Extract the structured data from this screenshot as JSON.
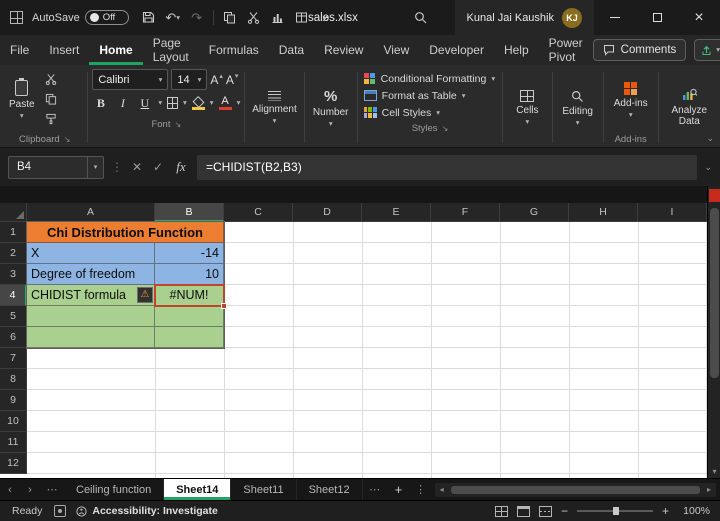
{
  "colors": {
    "accent_green": "#21A366",
    "title_fill_orange": "#ED7D31",
    "data_fill_blue": "#8EB4E3",
    "data_fill_green": "#A9D08E",
    "error_selection_red": "#C0452A",
    "addins_orange": "#E8590C"
  },
  "title_bar": {
    "autosave_label": "AutoSave",
    "autosave_state": "Off",
    "file_name": "sales.xlsx",
    "user_name": "Kunal Jai Kaushik",
    "user_initials": "KJ"
  },
  "menu": {
    "items": [
      "File",
      "Insert",
      "Home",
      "Page Layout",
      "Formulas",
      "Data",
      "Review",
      "View",
      "Developer",
      "Help",
      "Power Pivot"
    ],
    "active_item": "Home",
    "comments_label": "Comments"
  },
  "ribbon": {
    "paste_label": "Paste",
    "clipboard_group_label": "Clipboard",
    "font_name": "Calibri",
    "font_size": "14",
    "bold_label": "B",
    "italic_label": "I",
    "underline_label": "U",
    "font_group_label": "Font",
    "alignment_label": "Alignment",
    "number_label": "Number",
    "conditional_formatting_label": "Conditional Formatting",
    "format_as_table_label": "Format as Table",
    "cell_styles_label": "Cell Styles",
    "styles_group_label": "Styles",
    "cells_label": "Cells",
    "editing_label": "Editing",
    "addins_label": "Add-ins",
    "addins_group_label": "Add-ins",
    "analyze_data_label": "Analyze Data"
  },
  "formula_bar": {
    "name_box": "B4",
    "fx_label": "fx",
    "formula": "=CHIDIST(B2,B3)"
  },
  "grid": {
    "column_headers": [
      "A",
      "B",
      "C",
      "D",
      "E",
      "F",
      "G",
      "H",
      "I"
    ],
    "row_headers": [
      "1",
      "2",
      "3",
      "4",
      "5",
      "6",
      "7",
      "8",
      "9",
      "10",
      "11",
      "12"
    ],
    "selected_column": "B",
    "selected_row": "4",
    "cells": {
      "a1_merged": "Chi Distribution Function",
      "a2": "X",
      "b2": "-14",
      "a3": "Degree of freedom",
      "b3": "10",
      "a4": "CHIDIST formula",
      "b4_error": "#NUM!"
    }
  },
  "sheet_tabs": {
    "tabs": [
      {
        "label": "Ceiling function"
      },
      {
        "label": "Sheet14"
      },
      {
        "label": "Sheet11"
      },
      {
        "label": "Sheet12"
      }
    ],
    "active_tab": "Sheet14"
  },
  "status_bar": {
    "mode": "Ready",
    "accessibility": "Accessibility: Investigate",
    "zoom_level": "100%"
  }
}
